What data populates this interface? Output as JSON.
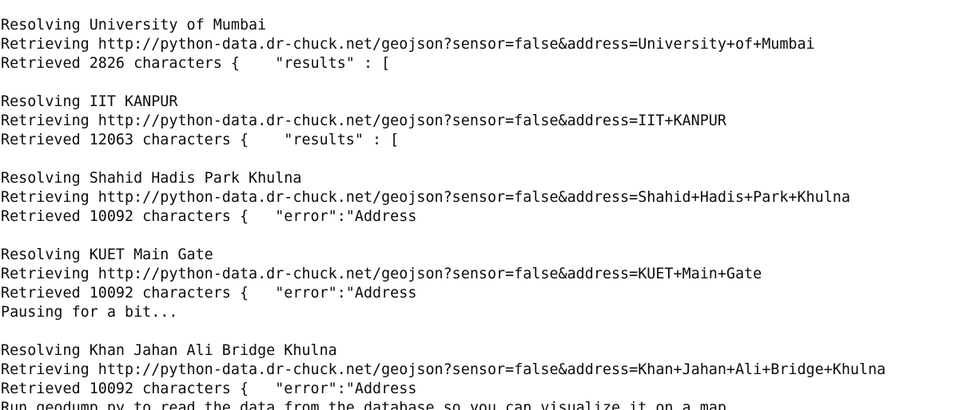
{
  "terminal": {
    "background": "#ffffff",
    "foreground": "#0c0c0c",
    "lines": [
      "Resolving University of Mumbai",
      "Retrieving http://python-data.dr-chuck.net/geojson?sensor=false&address=University+of+Mumbai",
      "Retrieved 2826 characters {    \"results\" : [",
      "",
      "Resolving IIT KANPUR",
      "Retrieving http://python-data.dr-chuck.net/geojson?sensor=false&address=IIT+KANPUR",
      "Retrieved 12063 characters {    \"results\" : [",
      "",
      "Resolving Shahid Hadis Park Khulna",
      "Retrieving http://python-data.dr-chuck.net/geojson?sensor=false&address=Shahid+Hadis+Park+Khulna",
      "Retrieved 10092 characters {   \"error\":\"Address",
      "",
      "Resolving KUET Main Gate",
      "Retrieving http://python-data.dr-chuck.net/geojson?sensor=false&address=KUET+Main+Gate",
      "Retrieved 10092 characters {   \"error\":\"Address",
      "Pausing for a bit...",
      "",
      "Resolving Khan Jahan Ali Bridge Khulna",
      "Retrieving http://python-data.dr-chuck.net/geojson?sensor=false&address=Khan+Jahan+Ali+Bridge+Khulna",
      "Retrieved 10092 characters {   \"error\":\"Address",
      "Run geodump.py to read the data from the database so you can visualize it on a map."
    ]
  }
}
